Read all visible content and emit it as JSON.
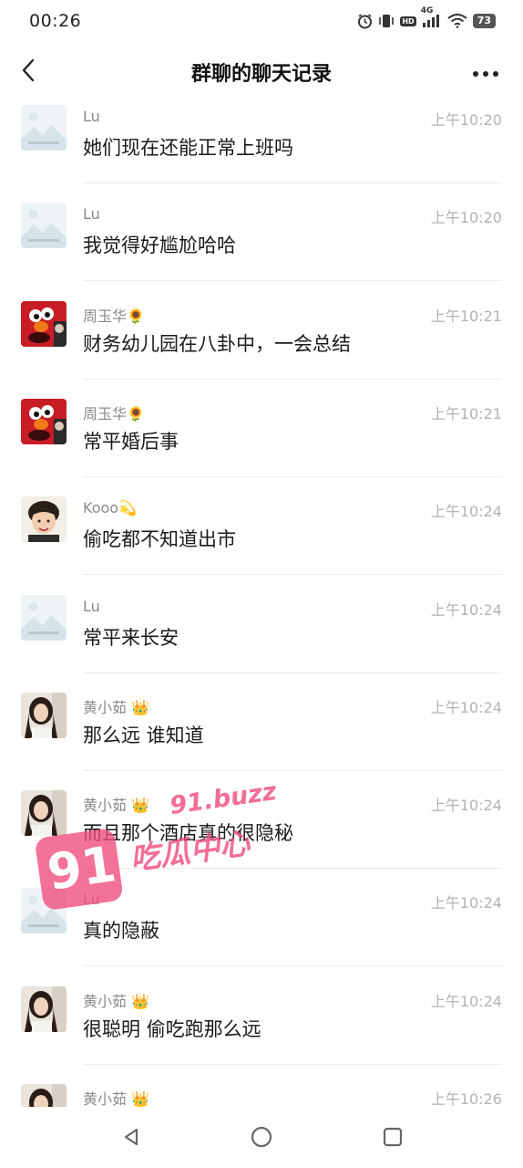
{
  "status_bar": {
    "time": "00:26",
    "network": "4G",
    "hd": "HD",
    "battery": "73"
  },
  "header": {
    "title": "群聊的聊天记录",
    "back_icon": "chevron-left-icon",
    "more_icon": "more-horizontal-icon"
  },
  "messages": [
    {
      "sender": "Lu",
      "time": "上午10:20",
      "text": "她们现在还能正常上班吗",
      "avatar": "placeholder"
    },
    {
      "sender": "Lu",
      "time": "上午10:20",
      "text": "我觉得好尴尬哈哈",
      "avatar": "placeholder"
    },
    {
      "sender": "周玉华🌻",
      "time": "上午10:21",
      "text": "财务幼儿园在八卦中，一会总结",
      "avatar": "red-monster"
    },
    {
      "sender": "周玉华🌻",
      "time": "上午10:21",
      "text": "常平婚后事",
      "avatar": "red-monster"
    },
    {
      "sender": "Kooo💫",
      "time": "上午10:24",
      "text": "偷吃都不知道出市",
      "avatar": "child"
    },
    {
      "sender": "Lu",
      "time": "上午10:24",
      "text": "常平来长安",
      "avatar": "placeholder"
    },
    {
      "sender": "黄小茹 👑",
      "time": "上午10:24",
      "text": "那么远  谁知道",
      "avatar": "woman"
    },
    {
      "sender": "黄小茹 👑",
      "time": "上午10:24",
      "text": "而且那个酒店真的很隐秘",
      "avatar": "woman"
    },
    {
      "sender": "Lu",
      "time": "上午10:24",
      "text": "真的隐蔽",
      "avatar": "placeholder"
    },
    {
      "sender": "黄小茹 👑",
      "time": "上午10:24",
      "text": "很聪明 偷吃跑那么远",
      "avatar": "woman"
    },
    {
      "sender": "黄小茹 👑",
      "time": "上午10:26",
      "text": "",
      "avatar": "woman"
    }
  ],
  "watermark": {
    "number": "91",
    "domain": "91.buzz",
    "text": "吃瓜中心"
  },
  "navigation": {
    "back": "back-triangle-icon",
    "home": "home-circle-icon",
    "recents": "recents-square-icon"
  }
}
